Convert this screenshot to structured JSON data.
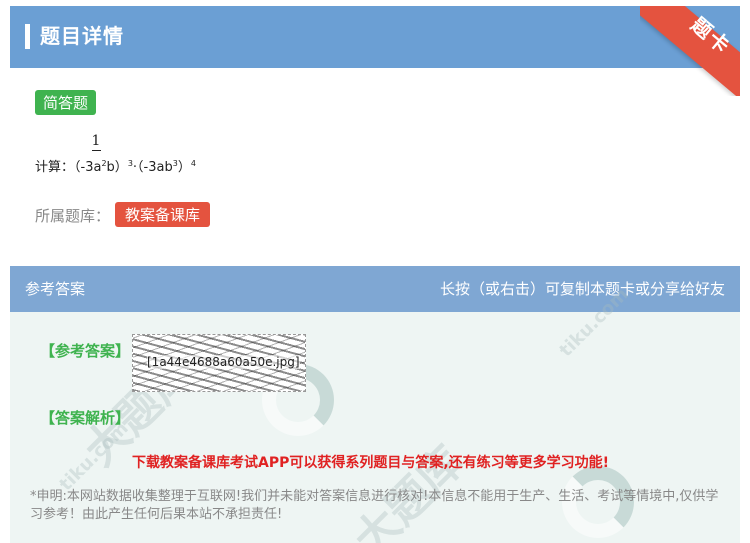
{
  "header": {
    "title": "题目详情",
    "ribbon": "题卡"
  },
  "question": {
    "type_badge": "简答题",
    "frac_num": "1",
    "prefix": "计算：（",
    "frac_den": "-3",
    "term1": "a",
    "term1_sup": "2",
    "term1_tail": "b）",
    "exp1": "3",
    "dot": "·",
    "term2": "（-3ab",
    "term2_sup": "3",
    "term2_tail": "）",
    "exp2": "4",
    "bank_label": "所属题库：",
    "bank_value": "教案备课库"
  },
  "answer": {
    "title": "参考答案",
    "hint": "长按（或右击）可复制本题卡或分享给好友",
    "ref_label": "【参考答案】",
    "image_alt": "[1a44e4688a60a50e.jpg]",
    "analysis_label": "【答案解析】",
    "promo": "下载教案备课库考试APP可以获得系列题目与答案,还有练习等更多学习功能!",
    "disclaimer": "*申明:本网站数据收集整理于互联网!我们并未能对答案信息进行核对!本信息不能用于生产、生活、考试等情境中,仅供学习参考！由此产生任何后果本站不承担责任!"
  },
  "watermark": {
    "text": "大题库",
    "site": "tiku.com"
  },
  "colors": {
    "header": "#6b9fd4",
    "answer_header": "#7fa7d3",
    "green": "#3fb34f",
    "red": "#e4533f",
    "promo": "#e02222"
  }
}
